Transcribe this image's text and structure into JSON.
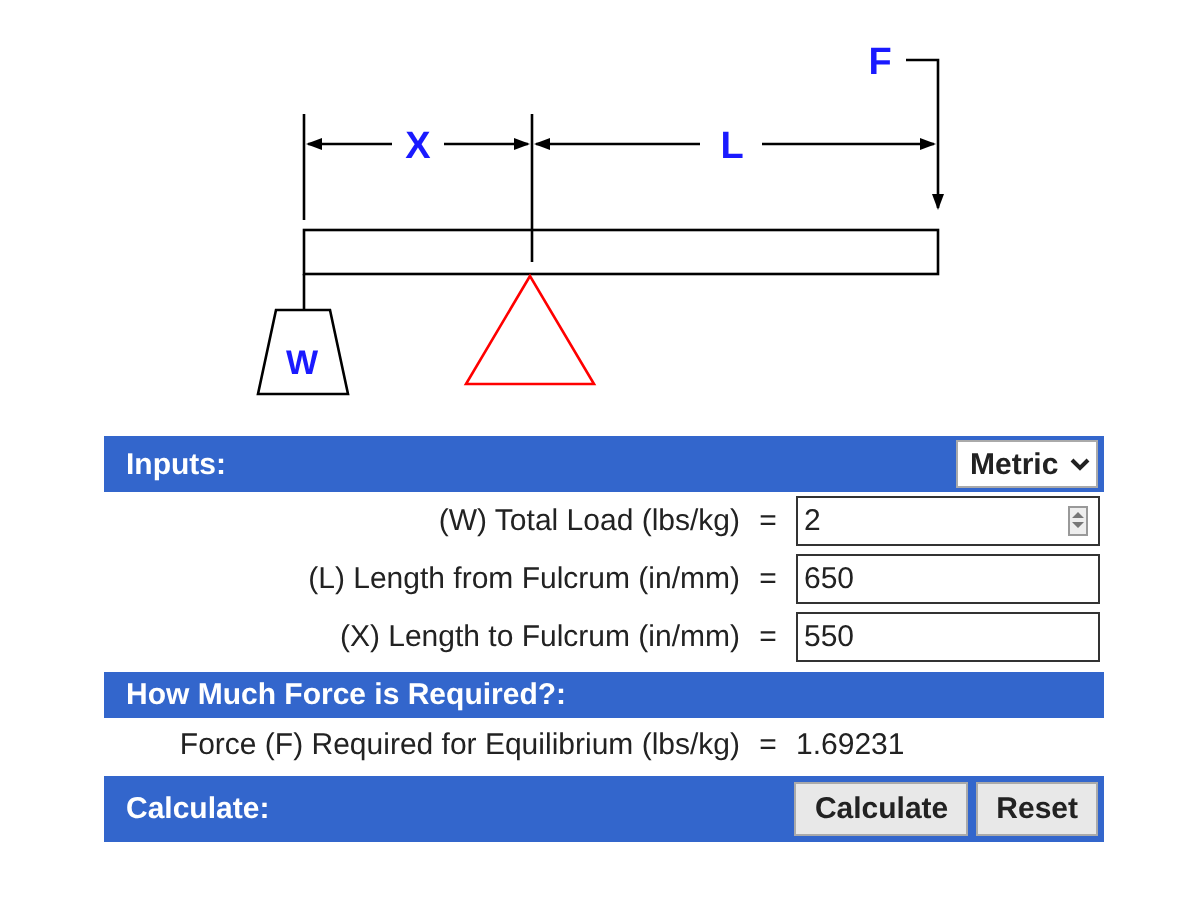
{
  "diagram": {
    "x_label": "X",
    "l_label": "L",
    "f_label": "F",
    "w_label": "W"
  },
  "inputs": {
    "title": "Inputs:",
    "unit_select": "Metric",
    "fields": [
      {
        "label": "(W) Total Load (lbs/kg)",
        "equals": "=",
        "value": "2",
        "kind": "spinner"
      },
      {
        "label": "(L) Length from Fulcrum (in/mm)",
        "equals": "=",
        "value": "650",
        "kind": "text"
      },
      {
        "label": "(X) Length to Fulcrum (in/mm)",
        "equals": "=",
        "value": "550",
        "kind": "text"
      }
    ]
  },
  "result": {
    "title": "How Much Force is Required?:",
    "label": "Force (F) Required for Equilibrium (lbs/kg)",
    "equals": "=",
    "value": "1.69231"
  },
  "calculate": {
    "title": "Calculate:",
    "buttons": [
      "Calculate",
      "Reset"
    ]
  }
}
